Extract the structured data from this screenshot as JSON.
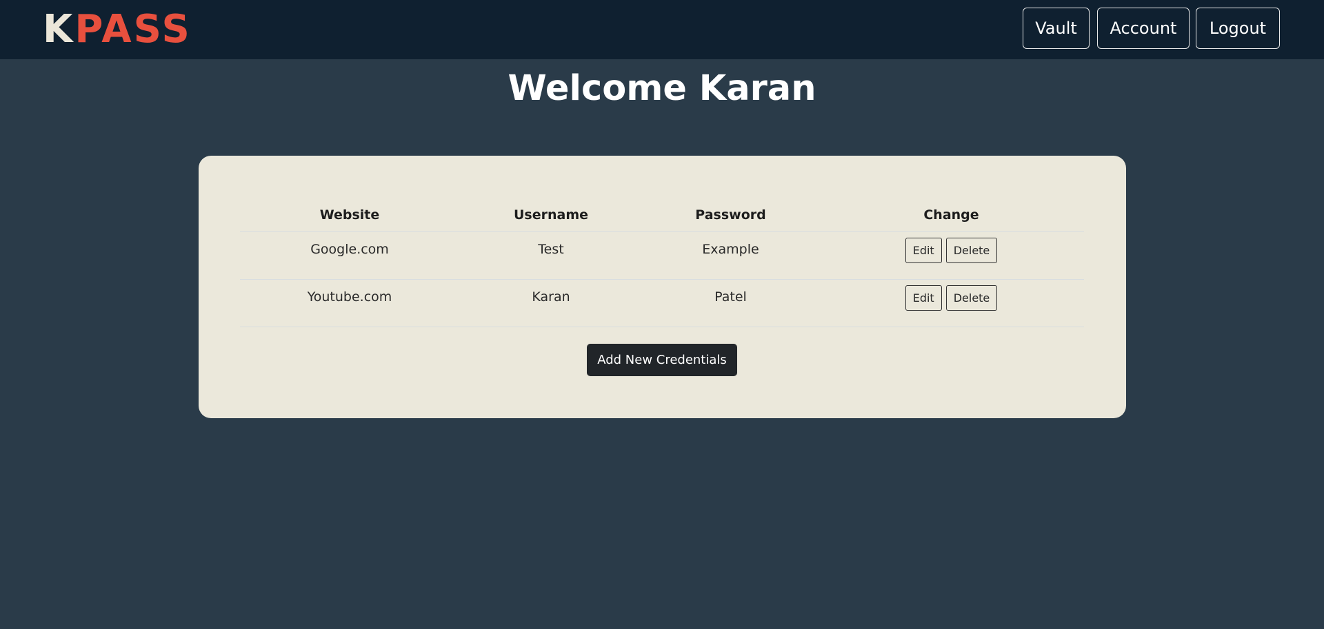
{
  "brand": {
    "logo_first": "K",
    "logo_rest": "PASS",
    "accent_color": "#e8503e",
    "light_color": "#ebe6d9"
  },
  "nav": {
    "vault": "Vault",
    "account": "Account",
    "logout": "Logout"
  },
  "page": {
    "title": "Welcome Karan"
  },
  "table": {
    "headers": {
      "website": "Website",
      "username": "Username",
      "password": "Password",
      "change": "Change"
    },
    "rows": [
      {
        "website": "Google.com",
        "username": "Test",
        "password": "Example",
        "edit": "Edit",
        "delete": "Delete"
      },
      {
        "website": "Youtube.com",
        "username": "Karan",
        "password": "Patel",
        "edit": "Edit",
        "delete": "Delete"
      }
    ]
  },
  "actions": {
    "add_label": "Add New Credentials"
  },
  "colors": {
    "background": "#2a3b49",
    "navbar": "#0f2030",
    "card": "#ebe8db",
    "primary_button": "#212529"
  }
}
